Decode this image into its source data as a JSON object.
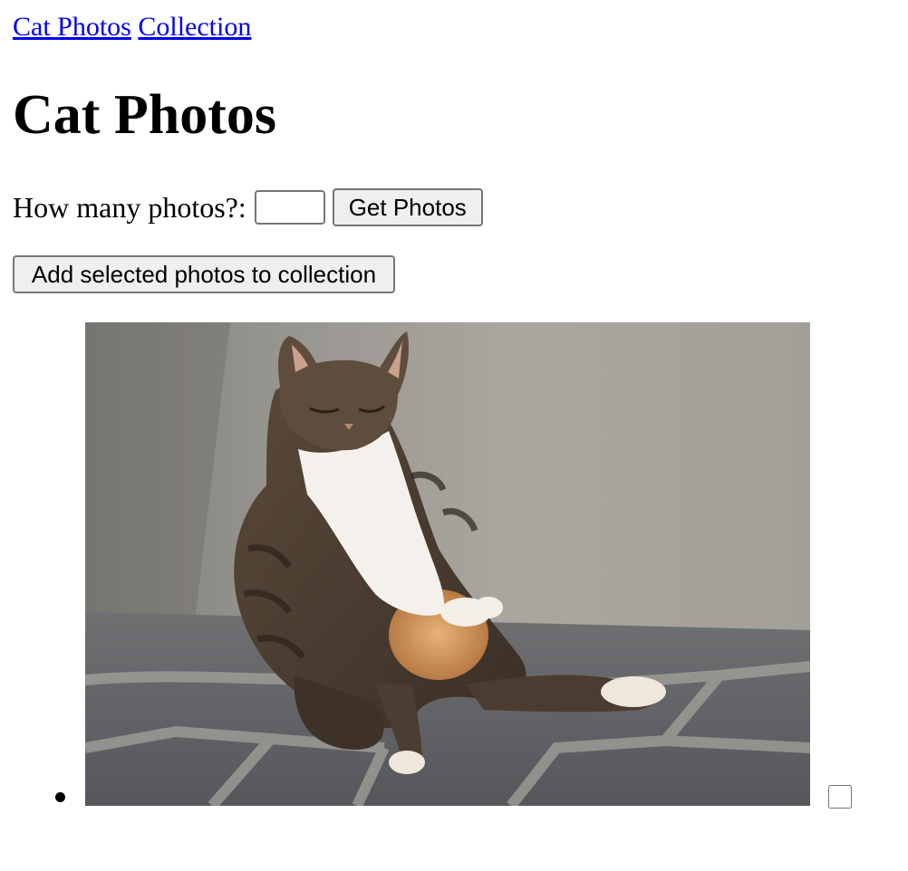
{
  "nav": {
    "links": [
      {
        "label": "Cat Photos"
      },
      {
        "label": "Collection"
      }
    ]
  },
  "page": {
    "title": "Cat Photos"
  },
  "photo_count": {
    "label": "How many photos?:",
    "value": "",
    "button_label": "Get Photos"
  },
  "actions": {
    "add_label": "Add selected photos to collection"
  },
  "photos": [
    {
      "subject": "tabby cat sitting against a wall",
      "selected": false
    }
  ],
  "colors": {
    "link": "#0000ee",
    "button_bg": "#efefef",
    "border": "#767676"
  }
}
